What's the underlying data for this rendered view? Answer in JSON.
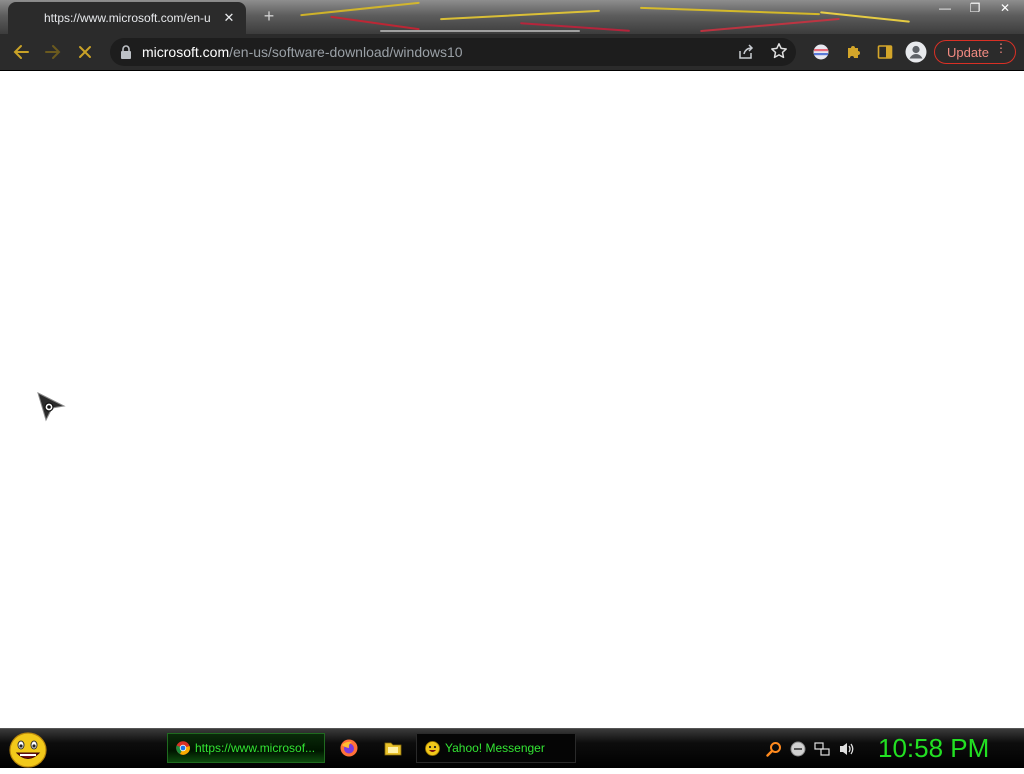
{
  "browser": {
    "tab": {
      "title": "https://www.microsoft.com/en-u",
      "close_glyph": "✕"
    },
    "new_tab_glyph": "+",
    "window_controls": {
      "minimize": "—",
      "restore": "❐",
      "close": "✕"
    },
    "address_bar": {
      "host": "microsoft.com",
      "path": "/en-us/software-download/windows10"
    },
    "update_button": {
      "label": "Update",
      "menu_glyph": "⋮"
    },
    "colors": {
      "frame": "#2b2b2b",
      "omnibox": "#1d1d1d",
      "url_host": "#ffffff",
      "url_path": "#9aa0a6",
      "update_accent": "#f28b82",
      "back_arrow": "#c9a227"
    },
    "icons": [
      "back-icon",
      "forward-icon",
      "stop-icon",
      "lock-icon",
      "share-icon",
      "star-icon",
      "flag-extension-icon",
      "puzzle-extension-icon",
      "side-panel-icon",
      "profile-icon"
    ]
  },
  "taskbar": {
    "tasks": [
      {
        "label": "https://www.microsof...",
        "icon": "chrome-icon"
      },
      {
        "label": "Yahoo! Messenger",
        "icon": "yahoo-smiley-icon"
      }
    ],
    "quick_launch": [
      "firefox-icon",
      "folder-icon"
    ],
    "tray_icons": [
      "search-icon",
      "messenger-status-icon",
      "network-icon",
      "volume-icon"
    ],
    "clock": "10:58 PM",
    "colors": {
      "text": "#33e533",
      "clock": "#22e022"
    }
  }
}
